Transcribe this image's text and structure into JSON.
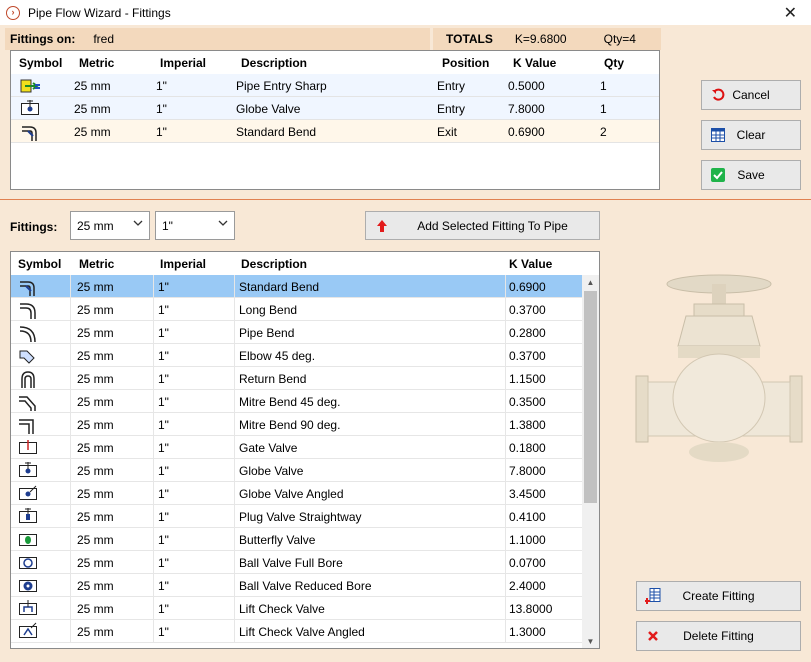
{
  "window": {
    "title": "Pipe Flow Wizard - Fittings",
    "close_glyph": "✕"
  },
  "fittings_on": {
    "label": "Fittings on:",
    "value": "fred"
  },
  "totals": {
    "label": "TOTALS",
    "k": "K=9.6800",
    "qty": "Qty=4"
  },
  "selected_grid": {
    "columns": [
      "Symbol",
      "Metric",
      "Imperial",
      "Description",
      "Position",
      "K Value",
      "Qty"
    ],
    "rows": [
      {
        "icon": "pipe-entry-sharp-icon",
        "metric": "25 mm",
        "imperial": "1\"",
        "description": "Pipe Entry Sharp",
        "position": "Entry",
        "k": "0.5000",
        "qty": "1"
      },
      {
        "icon": "globe-valve-icon",
        "metric": "25 mm",
        "imperial": "1\"",
        "description": "Globe Valve",
        "position": "Entry",
        "k": "7.8000",
        "qty": "1"
      },
      {
        "icon": "standard-bend-icon",
        "metric": "25 mm",
        "imperial": "1\"",
        "description": "Standard Bend",
        "position": "Exit",
        "k": "0.6900",
        "qty": "2"
      }
    ]
  },
  "buttons": {
    "cancel": "Cancel",
    "clear": "Clear",
    "save": "Save",
    "add": "Add Selected Fitting To Pipe",
    "create": "Create Fitting",
    "delete": "Delete Fitting"
  },
  "filter": {
    "label": "Fittings:",
    "metric": "25 mm",
    "imperial": "1\""
  },
  "catalog_grid": {
    "columns": [
      "Symbol",
      "Metric",
      "Imperial",
      "Description",
      "K Value"
    ],
    "selected_index": 0,
    "rows": [
      {
        "icon": "standard-bend-icon",
        "metric": "25 mm",
        "imperial": "1\"",
        "description": "Standard Bend",
        "k": "0.6900"
      },
      {
        "icon": "long-bend-icon",
        "metric": "25 mm",
        "imperial": "1\"",
        "description": "Long Bend",
        "k": "0.3700"
      },
      {
        "icon": "pipe-bend-icon",
        "metric": "25 mm",
        "imperial": "1\"",
        "description": "Pipe Bend",
        "k": "0.2800"
      },
      {
        "icon": "elbow-45-icon",
        "metric": "25 mm",
        "imperial": "1\"",
        "description": "Elbow 45 deg.",
        "k": "0.3700"
      },
      {
        "icon": "return-bend-icon",
        "metric": "25 mm",
        "imperial": "1\"",
        "description": "Return Bend",
        "k": "1.1500"
      },
      {
        "icon": "mitre-bend-45-icon",
        "metric": "25 mm",
        "imperial": "1\"",
        "description": "Mitre Bend 45 deg.",
        "k": "0.3500"
      },
      {
        "icon": "mitre-bend-90-icon",
        "metric": "25 mm",
        "imperial": "1\"",
        "description": "Mitre Bend 90 deg.",
        "k": "1.3800"
      },
      {
        "icon": "gate-valve-icon",
        "metric": "25 mm",
        "imperial": "1\"",
        "description": "Gate Valve",
        "k": "0.1800"
      },
      {
        "icon": "globe-valve-icon",
        "metric": "25 mm",
        "imperial": "1\"",
        "description": "Globe Valve",
        "k": "7.8000"
      },
      {
        "icon": "globe-valve-angled-icon",
        "metric": "25 mm",
        "imperial": "1\"",
        "description": "Globe Valve Angled",
        "k": "3.4500"
      },
      {
        "icon": "plug-valve-icon",
        "metric": "25 mm",
        "imperial": "1\"",
        "description": "Plug Valve Straightway",
        "k": "0.4100"
      },
      {
        "icon": "butterfly-valve-icon",
        "metric": "25 mm",
        "imperial": "1\"",
        "description": "Butterfly Valve",
        "k": "1.1000"
      },
      {
        "icon": "ball-valve-full-icon",
        "metric": "25 mm",
        "imperial": "1\"",
        "description": "Ball Valve Full Bore",
        "k": "0.0700"
      },
      {
        "icon": "ball-valve-reduced-icon",
        "metric": "25 mm",
        "imperial": "1\"",
        "description": "Ball Valve Reduced Bore",
        "k": "2.4000"
      },
      {
        "icon": "lift-check-valve-icon",
        "metric": "25 mm",
        "imperial": "1\"",
        "description": "Lift Check Valve",
        "k": "13.8000"
      },
      {
        "icon": "lift-check-valve-angled-icon",
        "metric": "25 mm",
        "imperial": "1\"",
        "description": "Lift Check Valve Angled",
        "k": "1.3000"
      }
    ]
  },
  "colors": {
    "selected_row": "#99c9f5",
    "panel": "#f8e8d6",
    "header_bar": "#f3d9bd",
    "accent_line": "#e08050"
  }
}
